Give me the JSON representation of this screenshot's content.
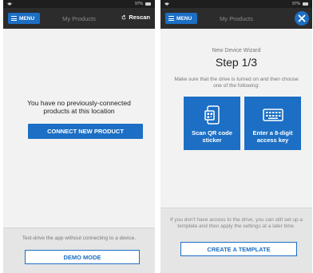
{
  "left": {
    "status": {
      "time": "",
      "battery": "97%"
    },
    "nav": {
      "menu_label": "MENU",
      "title": "My Products",
      "rescan_label": "Rescan"
    },
    "empty_message": "You have no previously-connected products at this location",
    "connect_button": "CONNECT NEW PRODUCT",
    "footer_text": "Test-drive the app without connecting to a device.",
    "demo_button": "DEMO MODE"
  },
  "right": {
    "status": {
      "battery": "97%"
    },
    "nav": {
      "menu_label": "MENU",
      "title": "My Products"
    },
    "wizard_subtitle": "New Device Wizard",
    "step": "Step 1/3",
    "description": "Make sure that the drive is turned on and then choose one of the following:",
    "tiles": [
      {
        "label": "Scan QR code sticker",
        "icon": "qr-phone-icon"
      },
      {
        "label": "Enter a 8-digit access key",
        "icon": "keypad-icon"
      }
    ],
    "footer_text": "If you don't have access to the drive, you can still set up a template and then apply the settings at a later time.",
    "template_button": "CREATE A TEMPLATE"
  },
  "colors": {
    "accent": "#1c6fc4",
    "navbar": "#2c2c2c",
    "statusbar": "#1e1e1e",
    "background": "#f2f2f2"
  }
}
